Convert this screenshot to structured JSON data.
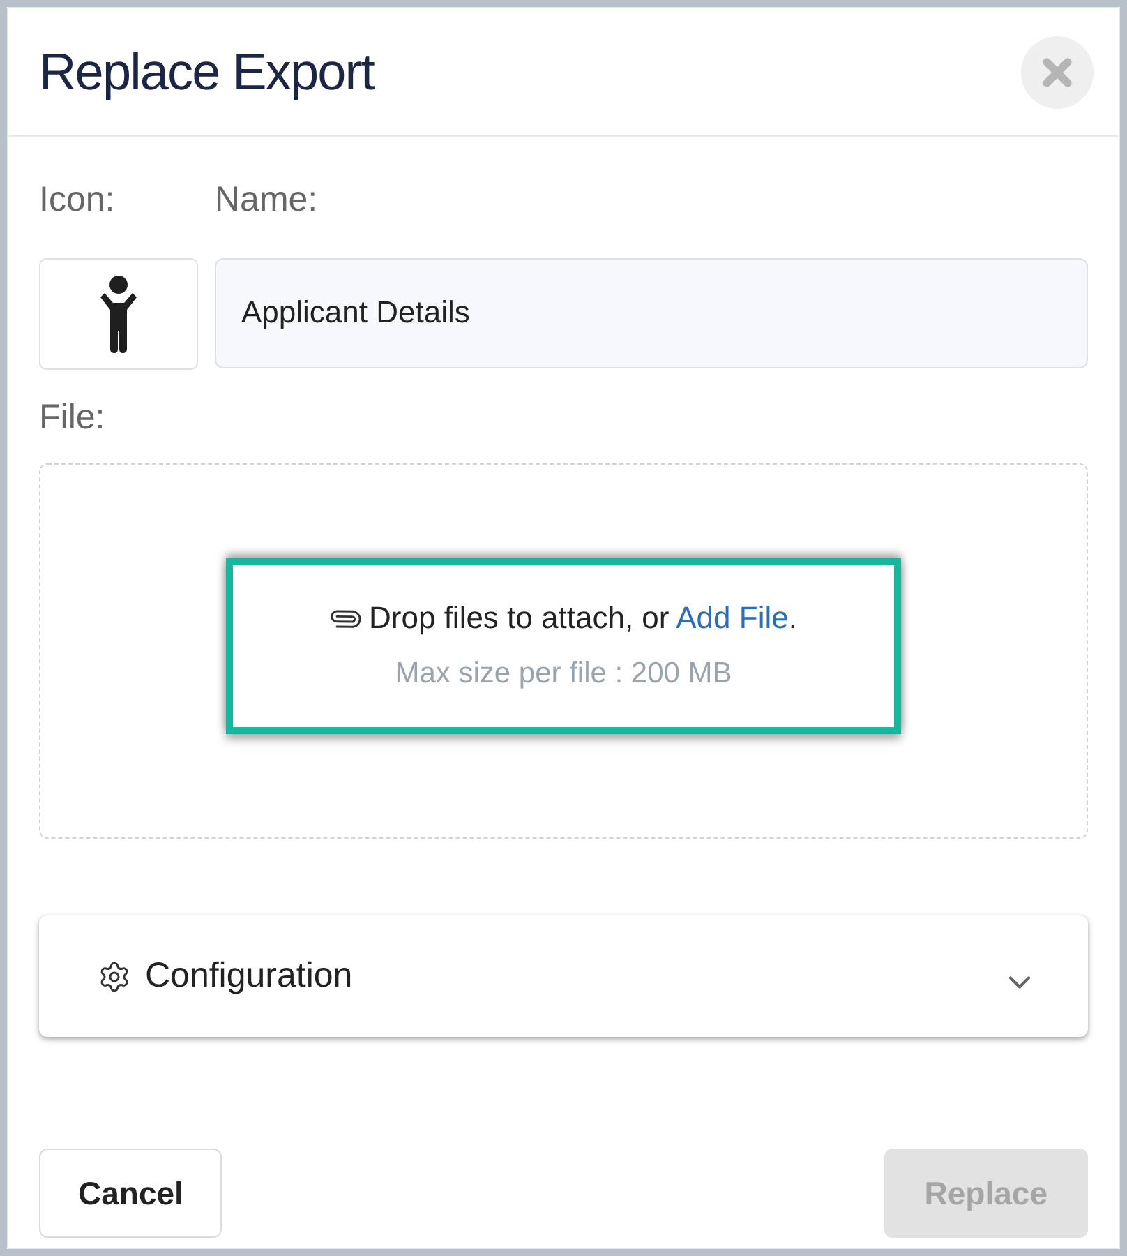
{
  "dialog": {
    "title": "Replace Export"
  },
  "icon_label": "Icon:",
  "name_label": "Name:",
  "name_field": {
    "value": "Applicant Details"
  },
  "file_label": "File:",
  "dropzone": {
    "text_before": "Drop files to attach, or ",
    "link": "Add File",
    "text_after": ".",
    "hint": "Max size per file : 200 MB"
  },
  "configuration": {
    "label": "Configuration",
    "expanded": false
  },
  "buttons": [
    {
      "label": "Cancel",
      "disabled": false
    },
    {
      "label": "Replace",
      "disabled": true
    }
  ]
}
